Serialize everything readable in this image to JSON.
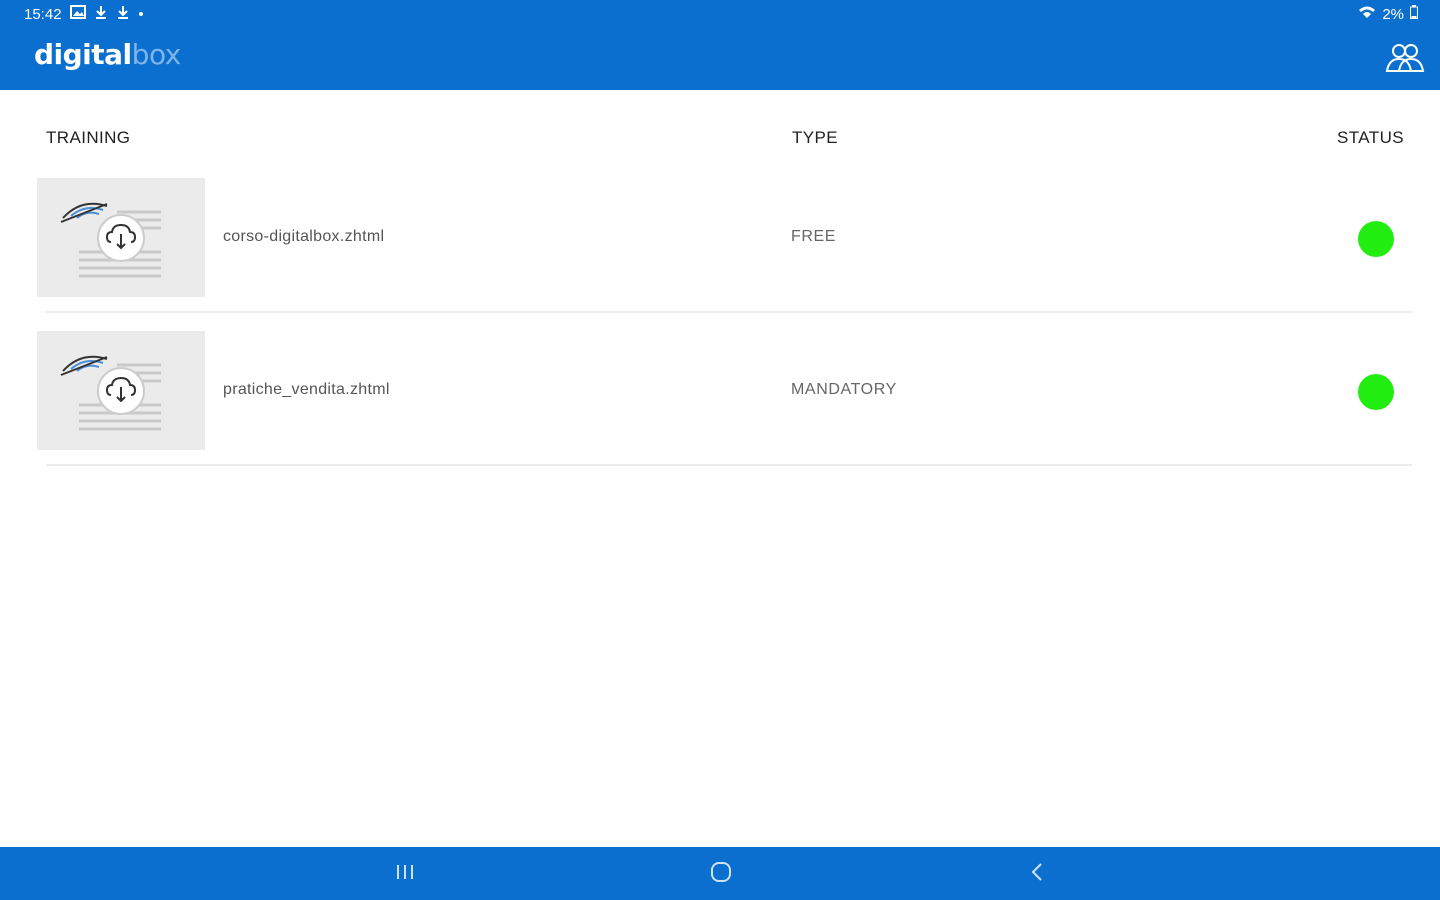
{
  "status_bar": {
    "time": "15:42",
    "battery": "2%"
  },
  "app_bar": {
    "logo_part1": "digital",
    "logo_part2": "box",
    "users_icon": "users-icon"
  },
  "table": {
    "headers": {
      "training": "TRAINING",
      "type": "TYPE",
      "status": "STATUS"
    },
    "rows": [
      {
        "name": "corso-digitalbox.zhtml",
        "type": "FREE",
        "status_color": "#22ee11"
      },
      {
        "name": "pratiche_vendita.zhtml",
        "type": "MANDATORY",
        "status_color": "#22ee11"
      }
    ]
  },
  "colors": {
    "brand_blue": "#0a6fcf",
    "status_ok": "#22ee11"
  }
}
